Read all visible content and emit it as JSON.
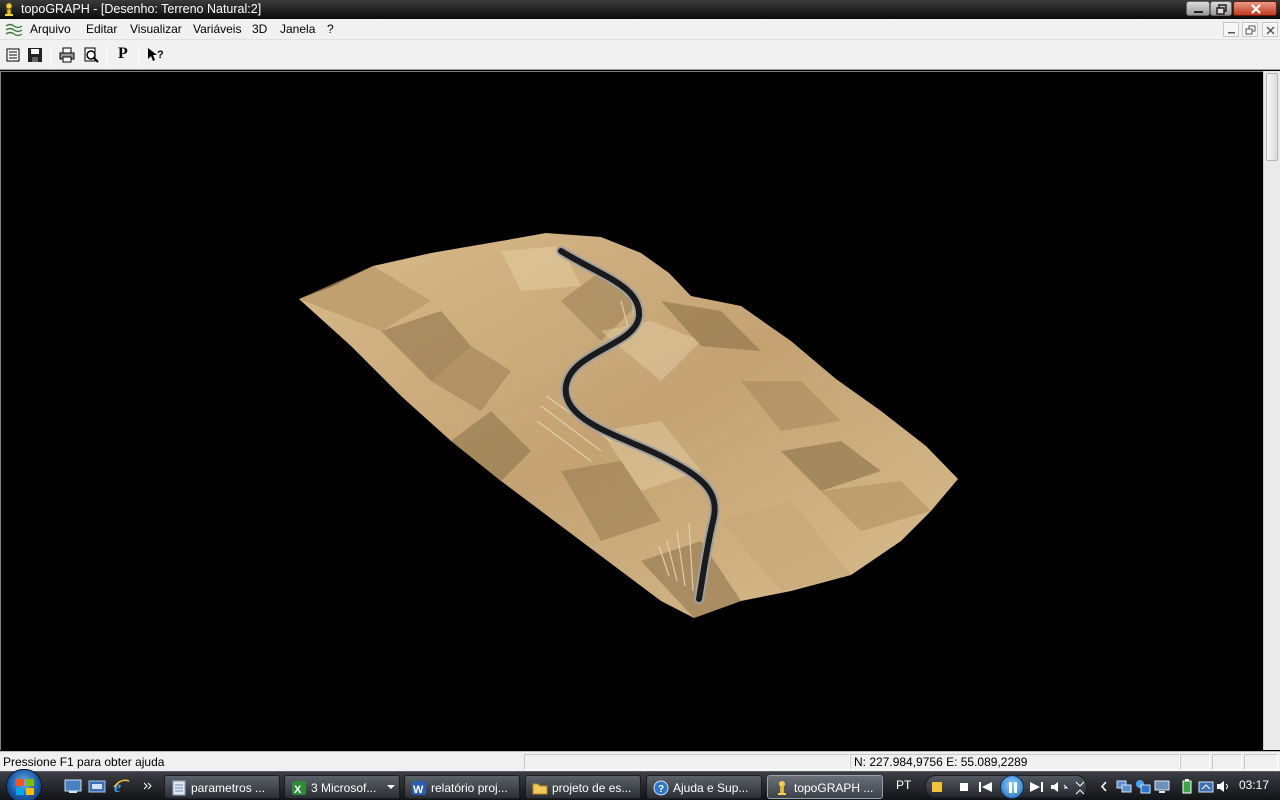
{
  "window": {
    "title": "topoGRAPH - [Desenho: Terreno Natural:2]"
  },
  "menu": {
    "items": [
      "Arquivo",
      "Editar",
      "Visualizar",
      "Variáveis",
      "3D",
      "Janela",
      "?"
    ]
  },
  "toolbar": {
    "buttons": [
      "list-icon",
      "save-icon",
      "print-icon",
      "print-preview-icon",
      "p-button",
      "context-help-icon"
    ],
    "p_label": "P"
  },
  "viewport": {
    "content": "3d-terrain-render",
    "background": "#000000",
    "terrain_color": "#c9a777",
    "road_color": "#1a1a1a"
  },
  "statusbar": {
    "help_text": "Pressione F1 para obter ajuda",
    "coordinates": "N: 227.984,9756 E: 55.089,2289"
  },
  "taskbar": {
    "tasks": [
      {
        "label": "parametros ...",
        "icon": "notepad-icon"
      },
      {
        "label": "3 Microsof...",
        "icon": "excel-icon"
      },
      {
        "label": "relatório proj...",
        "icon": "word-icon"
      },
      {
        "label": "projeto de es...",
        "icon": "folder-icon"
      },
      {
        "label": "Ajuda e Sup...",
        "icon": "help-icon"
      },
      {
        "label": "topoGRAPH ...",
        "icon": "topograph-icon"
      }
    ],
    "language": "PT",
    "clock": "03:17"
  }
}
